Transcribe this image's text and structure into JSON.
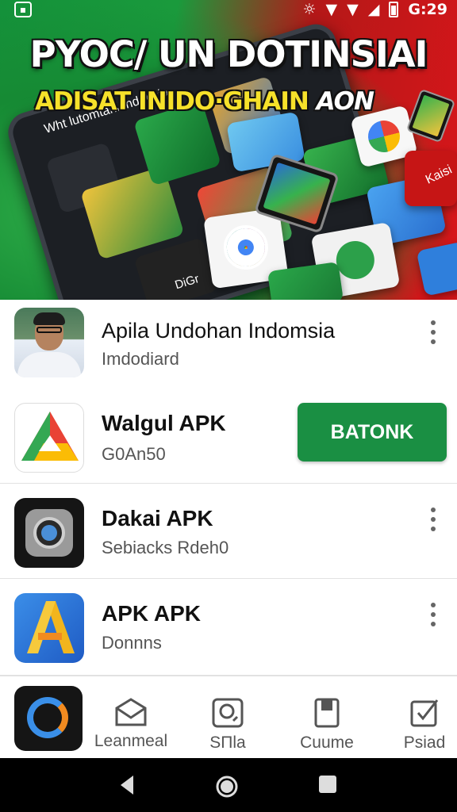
{
  "status_bar": {
    "time": "G:29"
  },
  "hero": {
    "title": "PYOC/ UN DOTINSIAI",
    "subtitle": "ADISAT INIDO·GHAIN",
    "subtitle_tail": "AON",
    "tablet_caption": "Wht lutomtahi Indehsia",
    "tile_caption": "DiGr",
    "side_caption": "Kaisi"
  },
  "list": {
    "featured": {
      "title": "Apila Undohan Indomsia",
      "subtitle": "Imdodiard"
    },
    "items": [
      {
        "title": "Walgul APK",
        "subtitle": "G0An50",
        "action": "BATONK"
      },
      {
        "title": "Dakai APK",
        "subtitle": "Sebiacks Rdeh0"
      },
      {
        "title": "APK APK",
        "subtitle": "Donnns"
      }
    ]
  },
  "bottom_nav": {
    "items": [
      {
        "label": "Leanmeal",
        "icon": "envelope-icon"
      },
      {
        "label": "SПla",
        "icon": "search-icon"
      },
      {
        "label": "Cuume",
        "icon": "book-icon"
      },
      {
        "label": "Psiad",
        "icon": "checkbox-icon"
      }
    ]
  },
  "colors": {
    "accent": "#1a8f43",
    "banner_green": "#168a34",
    "banner_red": "#d8161a"
  }
}
